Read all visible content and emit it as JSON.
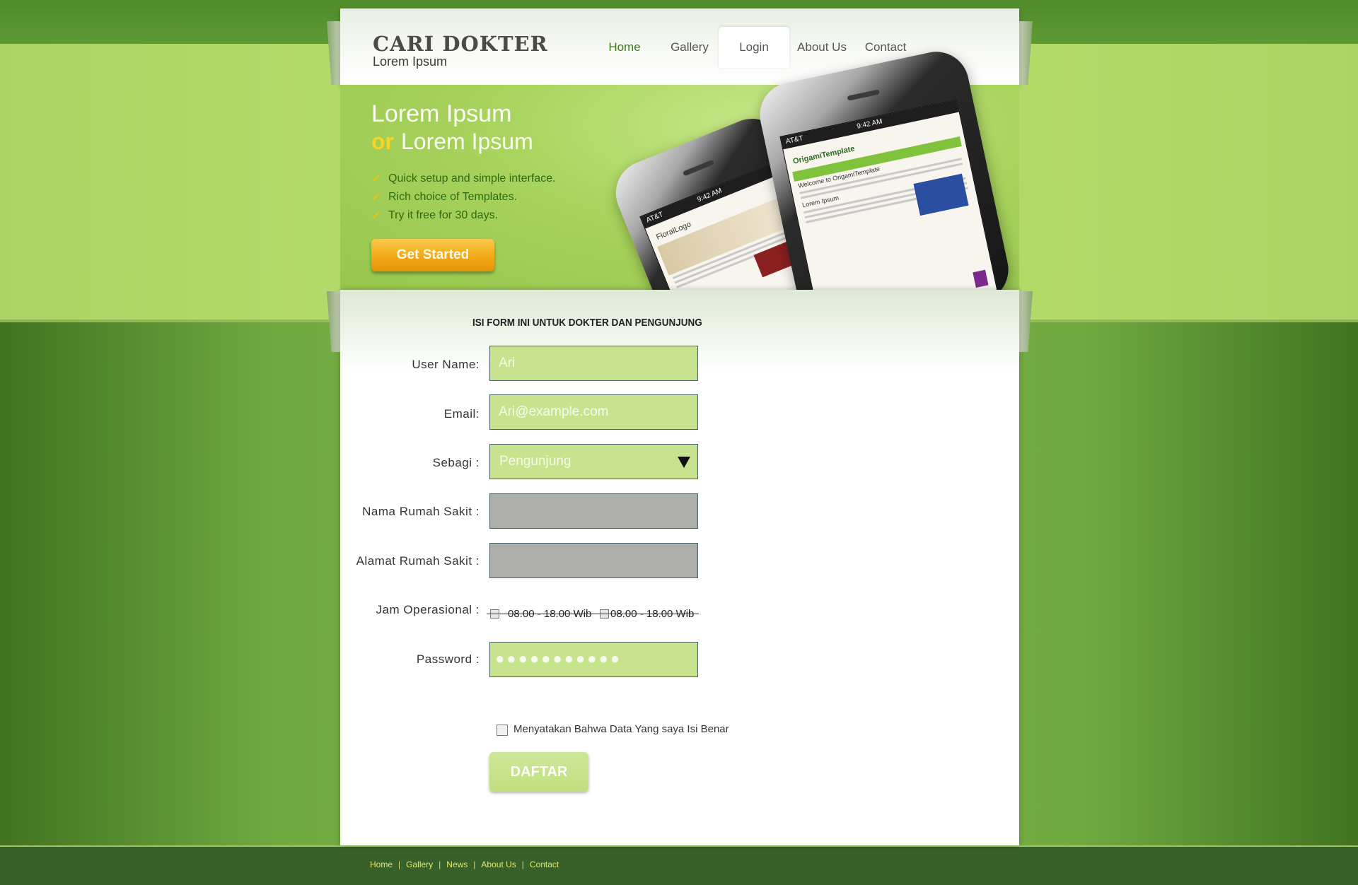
{
  "header": {
    "logo_title": "CARI DOKTER",
    "logo_subtitle": "Lorem Ipsum",
    "nav": [
      {
        "label": "Home"
      },
      {
        "label": "Gallery"
      },
      {
        "label": "Login"
      },
      {
        "label": "About Us"
      },
      {
        "label": "Contact"
      }
    ]
  },
  "hero": {
    "title_line1": "Lorem Ipsum",
    "or": "or",
    "title_line2": "Lorem Ipsum",
    "bullets": [
      "Quick setup and simple interface.",
      "Rich choice of Templates.",
      "Try it free for 30 days."
    ],
    "cta_label": "Get Started",
    "phone_screens": {
      "time": "9:42 AM",
      "carrier": "AT&T",
      "front_logo": "OrigamiTemplate",
      "front_heading": "Welcome to OrigamiTemplate",
      "front_caption": "Lorem Ipsum",
      "back_logo": "FloralLogo"
    }
  },
  "form": {
    "heading": "ISI FORM INI UNTUK DOKTER DAN PENGUNJUNG",
    "username_label": "User Name:",
    "username_value": "Ari",
    "email_label": "Email:",
    "email_value": "Ari@example.com",
    "sebagai_label": "Sebagi :",
    "sebagai_value": "Pengunjung",
    "nama_rs_label": "Nama Rumah Sakit :",
    "nama_rs_value": "",
    "alamat_rs_label": "Alamat Rumah Sakit :",
    "alamat_rs_value": "",
    "jam_label": "Jam Operasional :",
    "jam_option1": "08.00 - 18.00 Wib",
    "jam_option2": "08.00 - 18.00 Wib",
    "password_label": "Password :",
    "password_mask": "●●●●●●●●●●●",
    "agree_label": "Menyatakan Bahwa Data Yang saya Isi Benar",
    "submit_label": "DAFTAR"
  },
  "footer": {
    "links": [
      "Home",
      "Gallery",
      "News",
      "About Us",
      "Contact"
    ],
    "separator": "|"
  }
}
